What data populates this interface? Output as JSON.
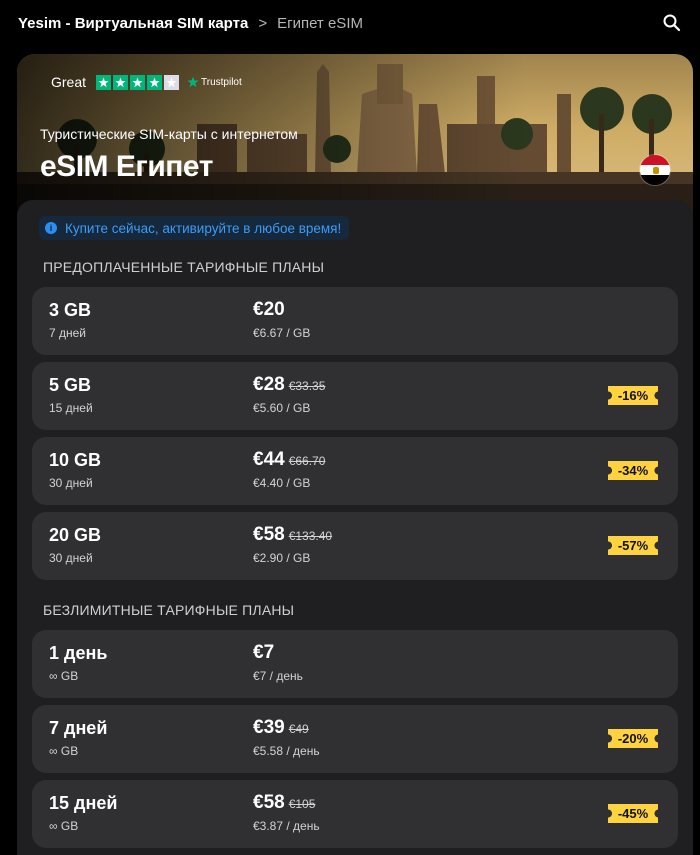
{
  "breadcrumb": {
    "home": "Yesim - Виртуальная SIM карта",
    "separator": ">",
    "current": "Египет eSIM"
  },
  "header": {
    "search_icon": "search-icon"
  },
  "hero": {
    "rating_word": "Great",
    "rating_stars": 4,
    "rating_max": 5,
    "rating_source": "Trustpilot",
    "subtitle": "Туристические SIM-карты с интернетом",
    "title": "eSIM Египет",
    "flag": "egypt-flag-icon"
  },
  "notice": {
    "icon": "info-icon",
    "text": "Купите сейчас, активируйте в любое время!"
  },
  "prepaid": {
    "section_title": "ПРЕДОПЛАЧЕННЫЕ ТАРИФНЫЕ ПЛАНЫ",
    "plans": [
      {
        "size": "3 GB",
        "duration": "7 дней",
        "price": "€20",
        "old_price": "",
        "unit_price": "€6.67 / GB",
        "discount": ""
      },
      {
        "size": "5 GB",
        "duration": "15 дней",
        "price": "€28",
        "old_price": "€33.35",
        "unit_price": "€5.60 / GB",
        "discount": "-16%"
      },
      {
        "size": "10 GB",
        "duration": "30 дней",
        "price": "€44",
        "old_price": "€66.70",
        "unit_price": "€4.40 / GB",
        "discount": "-34%"
      },
      {
        "size": "20 GB",
        "duration": "30 дней",
        "price": "€58",
        "old_price": "€133.40",
        "unit_price": "€2.90 / GB",
        "discount": "-57%"
      }
    ]
  },
  "unlimited": {
    "section_title": "БЕЗЛИМИТНЫЕ ТАРИФНЫЕ ПЛАНЫ",
    "plans": [
      {
        "size": "1 день",
        "duration": "∞ GB",
        "price": "€7",
        "old_price": "",
        "unit_price": "€7 / день",
        "discount": ""
      },
      {
        "size": "7 дней",
        "duration": "∞ GB",
        "price": "€39",
        "old_price": "€49",
        "unit_price": "€5.58 / день",
        "discount": "-20%"
      },
      {
        "size": "15 дней",
        "duration": "∞ GB",
        "price": "€58",
        "old_price": "€105",
        "unit_price": "€3.87 / день",
        "discount": "-45%"
      }
    ]
  },
  "colors": {
    "background": "#000000",
    "card": "#1f1f21",
    "plan_row": "#303033",
    "badge": "#ffd23f",
    "notice_bg": "#15283c",
    "notice_text": "#3d9bf5",
    "trustpilot_green": "#00b67a"
  }
}
